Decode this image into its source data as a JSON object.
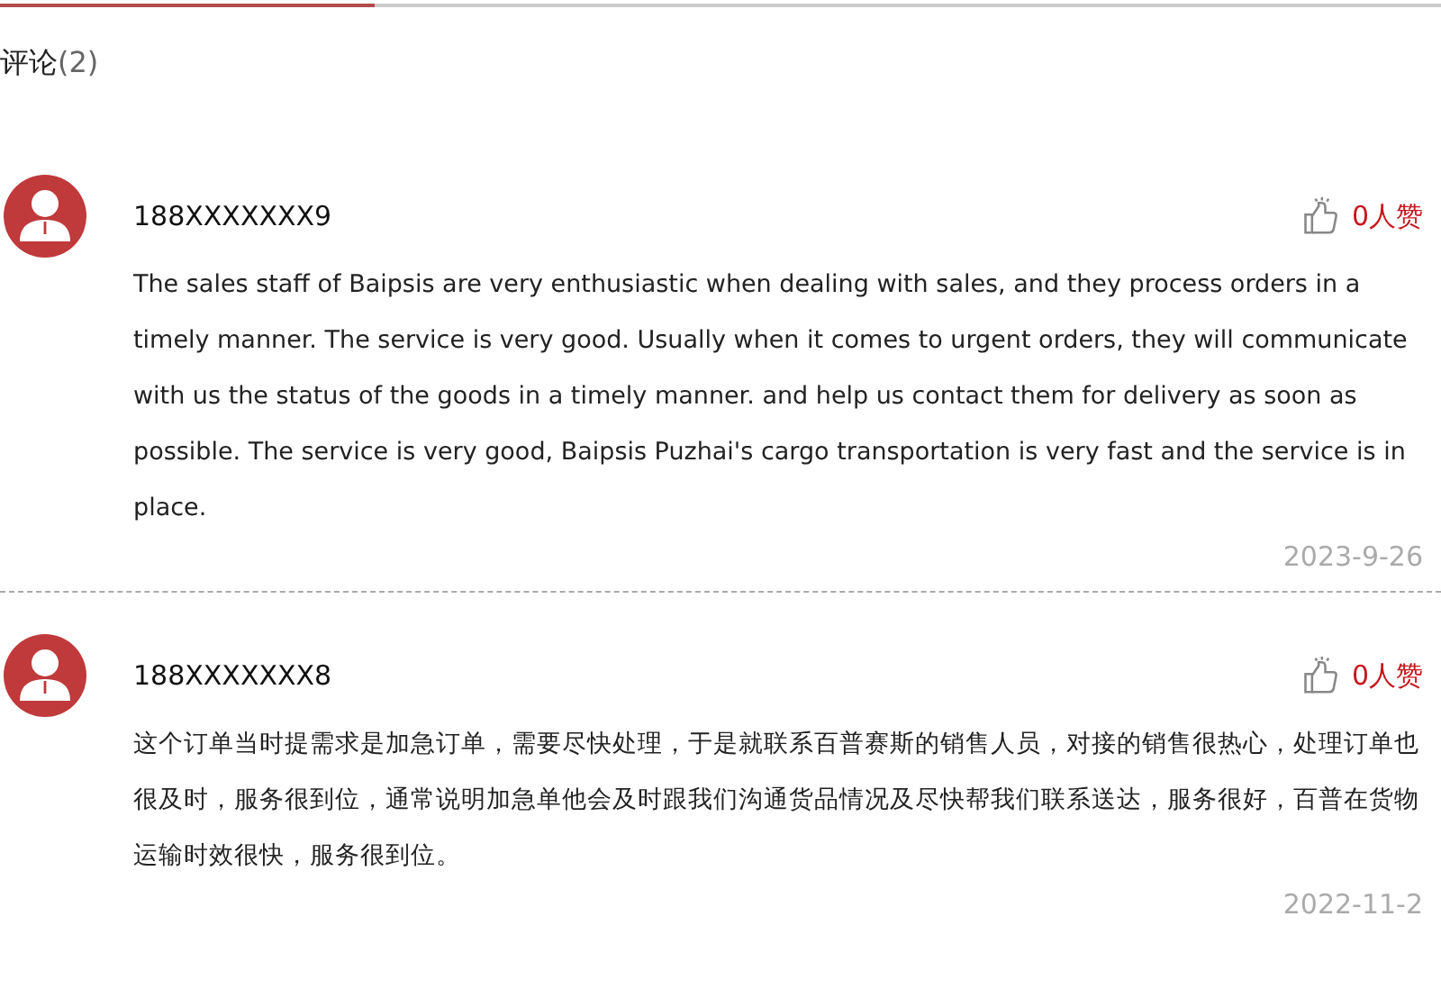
{
  "heading": {
    "label": "评论",
    "count": "(2)"
  },
  "comments": [
    {
      "user": "188XXXXXXX9",
      "likes": "0人赞",
      "text": "The sales staff of Baipsis are very enthusiastic when dealing with sales, and they process orders in a timely manner. The service is very good. Usually when it comes to urgent orders, they will communicate with us the status of the goods in a timely manner. and help us contact them for delivery as soon as possible. The service is very good, Baipsis Puzhai's cargo transportation is very fast and the service is in place.",
      "date": "2023-9-26"
    },
    {
      "user": "188XXXXXXX8",
      "likes": "0人赞",
      "text": "这个订单当时提需求是加急订单，需要尽快处理，于是就联系百普赛斯的销售人员，对接的销售很热心，处理订单也很及时，服务很到位，通常说明加急单他会及时跟我们沟通货品情况及尽快帮我们联系送达，服务很好，百普在货物运输时效很快，服务很到位。",
      "date": "2022-11-2"
    }
  ]
}
